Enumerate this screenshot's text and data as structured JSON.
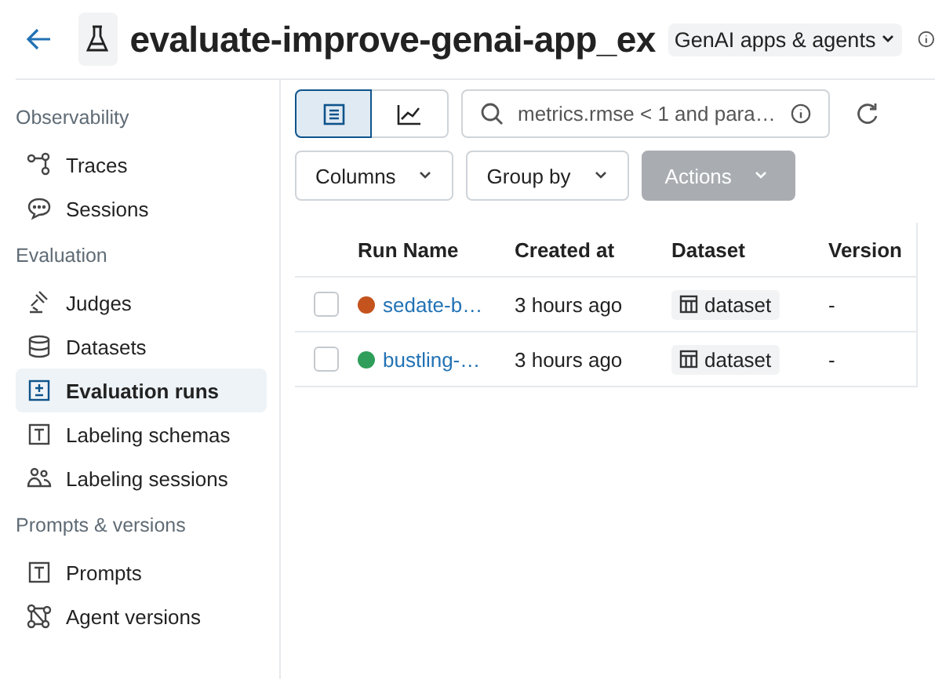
{
  "header": {
    "title": "evaluate-improve-genai-app_ex",
    "workspace": "GenAI apps & agents"
  },
  "sidebar": {
    "sections": [
      {
        "label": "Observability",
        "items": [
          {
            "label": "Traces",
            "selected": false
          },
          {
            "label": "Sessions",
            "selected": false
          }
        ]
      },
      {
        "label": "Evaluation",
        "items": [
          {
            "label": "Judges",
            "selected": false
          },
          {
            "label": "Datasets",
            "selected": false
          },
          {
            "label": "Evaluation runs",
            "selected": true
          },
          {
            "label": "Labeling schemas",
            "selected": false
          },
          {
            "label": "Labeling sessions",
            "selected": false
          }
        ]
      },
      {
        "label": "Prompts & versions",
        "items": [
          {
            "label": "Prompts",
            "selected": false
          },
          {
            "label": "Agent versions",
            "selected": false
          }
        ]
      }
    ]
  },
  "toolbar": {
    "views": [
      {
        "kind": "table",
        "selected": true
      },
      {
        "kind": "chart",
        "selected": false
      }
    ],
    "search": {
      "placeholder": "metrics.rmse < 1 and para…"
    },
    "buttons": [
      {
        "label": "Columns",
        "disabled": false
      },
      {
        "label": "Group by",
        "disabled": false
      },
      {
        "label": "Actions",
        "disabled": true
      }
    ]
  },
  "table": {
    "columns": [
      "Run Name",
      "Created at",
      "Dataset",
      "Version"
    ],
    "rows": [
      {
        "checked": false,
        "color": "#c4531e",
        "name": "sedate-b…",
        "created": "3 hours ago",
        "dataset": "dataset",
        "version": "-"
      },
      {
        "checked": false,
        "color": "#2e9e5a",
        "name": "bustling-…",
        "created": "3 hours ago",
        "dataset": "dataset",
        "version": "-"
      }
    ]
  }
}
